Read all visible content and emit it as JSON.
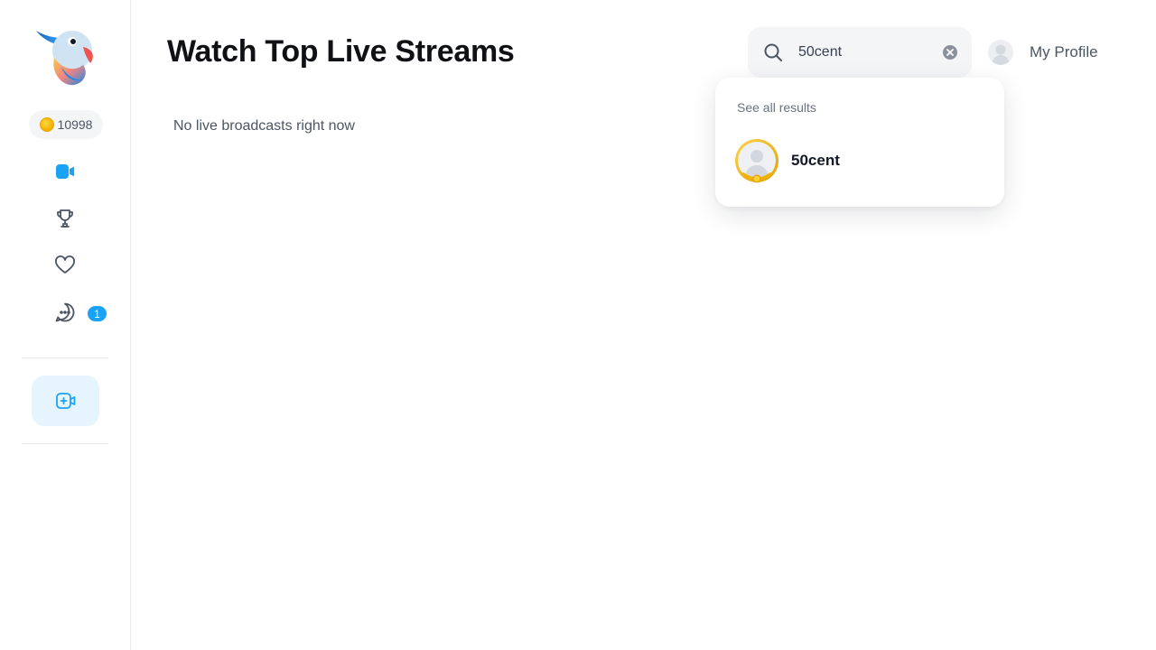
{
  "sidebar": {
    "coins": "10998",
    "messages_badge": "1",
    "items": [
      {
        "name": "live-streams",
        "icon": "video-camera-icon",
        "active": true
      },
      {
        "name": "leaderboard",
        "icon": "trophy-icon",
        "active": false
      },
      {
        "name": "favorites",
        "icon": "heart-icon",
        "active": false
      },
      {
        "name": "messages",
        "icon": "chat-bubble-icon",
        "active": false
      }
    ],
    "go_live_icon": "add-video-icon"
  },
  "main": {
    "title": "Watch Top Live Streams",
    "empty_message": "No live broadcasts right now"
  },
  "search": {
    "value": "50cent",
    "placeholder": "",
    "dropdown": {
      "see_all_label": "See all results",
      "results": [
        {
          "name": "50cent"
        }
      ]
    }
  },
  "profile": {
    "label": "My Profile"
  },
  "colors": {
    "accent": "#1aa3f5",
    "text_primary": "#0f1115",
    "text_secondary": "#4b5563",
    "input_bg": "#f4f5f7",
    "gold": "#f5b400"
  }
}
